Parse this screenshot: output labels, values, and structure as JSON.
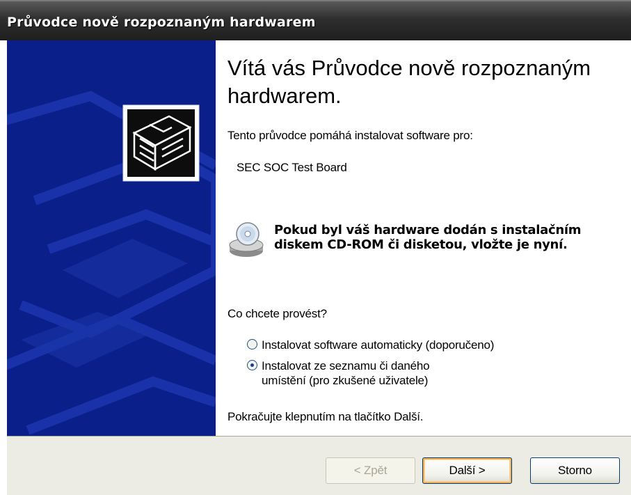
{
  "window": {
    "title": "Průvodce nově rozpoznaným hardwarem"
  },
  "main": {
    "heading": "Vítá vás Průvodce nově rozpoznaným hardwarem.",
    "intro": "Tento průvodce pomáhá instalovat software pro:",
    "device_name": "SEC SOC Test Board",
    "cd_note": "Pokud byl váš hardware dodán s instalačním diskem CD-ROM či disketou, vložte je nyní.",
    "question": "Co chcete provést?",
    "options": [
      {
        "label": "Instalovat software automaticky (doporučeno)",
        "selected": false
      },
      {
        "label": "Instalovat ze seznamu či daného umístění (pro zkušené uživatele)",
        "selected": true
      }
    ],
    "continue_text": "Pokračujte klepnutím na tlačítko Další."
  },
  "buttons": {
    "back": {
      "label": "< Zpět",
      "enabled": false
    },
    "next": {
      "label": "Další >",
      "enabled": true,
      "default": true
    },
    "cancel": {
      "label": "Storno",
      "enabled": true
    }
  },
  "icons": {
    "wizard": "hardware-card-icon",
    "cd": "cd-rom-icon"
  },
  "colors": {
    "titlebar": "#2e2e2e",
    "left_panel": "#0b1f8a",
    "button_bar": "#ecebe4"
  }
}
